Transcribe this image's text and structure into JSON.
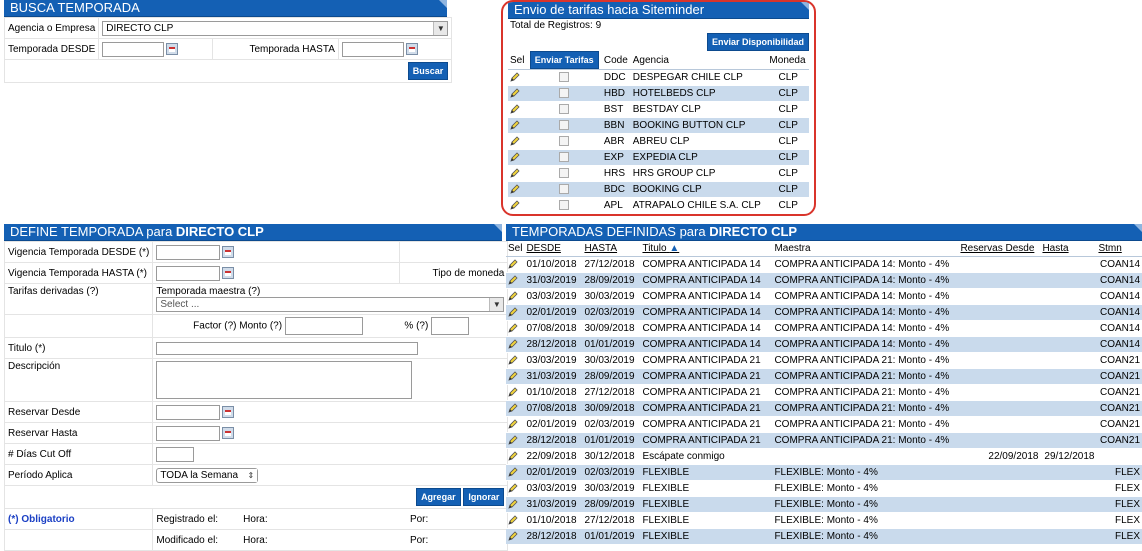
{
  "busca": {
    "title": "BUSCA TEMPORADA",
    "agencia_label": "Agencia o Empresa",
    "agencia_value": "DIRECTO CLP",
    "desde_label": "Temporada DESDE",
    "hasta_label": "Temporada HASTA",
    "buscar_label": "Buscar"
  },
  "envio": {
    "title": "Envio de tarifas hacia Siteminder",
    "total_label": "Total de Registros: 9",
    "enviar_disp_label": "Enviar Disponibilidad",
    "col_sel": "Sel",
    "enviar_tarifas_label": "Enviar Tarifas",
    "col_code": "Code",
    "col_agencia": "Agencia",
    "col_moneda": "Moneda",
    "rows": [
      {
        "code": "DDC",
        "agencia": "DESPEGAR CHILE CLP",
        "moneda": "CLP"
      },
      {
        "code": "HBD",
        "agencia": "HOTELBEDS CLP",
        "moneda": "CLP"
      },
      {
        "code": "BST",
        "agencia": "BESTDAY CLP",
        "moneda": "CLP"
      },
      {
        "code": "BBN",
        "agencia": "BOOKING BUTTON CLP",
        "moneda": "CLP"
      },
      {
        "code": "ABR",
        "agencia": "ABREU CLP",
        "moneda": "CLP"
      },
      {
        "code": "EXP",
        "agencia": "EXPEDIA CLP",
        "moneda": "CLP"
      },
      {
        "code": "HRS",
        "agencia": "HRS GROUP CLP",
        "moneda": "CLP"
      },
      {
        "code": "BDC",
        "agencia": "BOOKING CLP",
        "moneda": "CLP"
      },
      {
        "code": "APL",
        "agencia": "ATRAPALO CHILE S.A. CLP",
        "moneda": "CLP"
      }
    ]
  },
  "define": {
    "title_prefix": "DEFINE TEMPORADA para ",
    "title_bold": "DIRECTO CLP",
    "vig_desde_label": "Vigencia Temporada DESDE (*)",
    "vig_hasta_label": "Vigencia Temporada HASTA (*)",
    "tipo_moneda_label": "Tipo de moneda",
    "tarifas_derivadas_label": "Tarifas derivadas (?)",
    "temporada_maestra_label": "Temporada maestra (?)",
    "select_placeholder": "Select ...",
    "factor_label": "Factor (?)",
    "monto_label": "Monto (?)",
    "pct_label": "% (?)",
    "titulo_label": "Titulo (*)",
    "descripcion_label": "Descripción",
    "reservar_desde_label": "Reservar Desde",
    "reservar_hasta_label": "Reservar Hasta",
    "dias_cutoff_label": "# Días Cut Off",
    "periodo_label": "Período Aplica",
    "periodo_value": "TODA la Semana",
    "agregar_label": "Agregar",
    "ignorar_label": "Ignorar",
    "obligatorio_label": "(*) Obligatorio",
    "registrado_label": "Registrado el:",
    "modificado_label": "Modificado el:",
    "hora_label": "Hora:",
    "por_label": "Por:"
  },
  "temporadas": {
    "title_prefix": "TEMPORADAS DEFINIDAS para ",
    "title_bold": "DIRECTO CLP",
    "col_sel": "Sel",
    "col_desde": "DESDE",
    "col_hasta": "HASTA",
    "col_titulo": "Titulo",
    "col_maestra": "Maestra",
    "col_res_desde": "Reservas Desde",
    "col_res_hasta": "Hasta",
    "col_stmn": "Stmn",
    "rows": [
      {
        "desde": "01/10/2018",
        "hasta": "27/12/2018",
        "titulo": "COMPRA ANTICIPADA 14",
        "maestra": "COMPRA ANTICIPADA 14: Monto - 4%",
        "rd": "",
        "rh": "",
        "stmn": "COAN14"
      },
      {
        "desde": "31/03/2019",
        "hasta": "28/09/2019",
        "titulo": "COMPRA ANTICIPADA 14",
        "maestra": "COMPRA ANTICIPADA 14: Monto - 4%",
        "rd": "",
        "rh": "",
        "stmn": "COAN14"
      },
      {
        "desde": "03/03/2019",
        "hasta": "30/03/2019",
        "titulo": "COMPRA ANTICIPADA 14",
        "maestra": "COMPRA ANTICIPADA 14: Monto - 4%",
        "rd": "",
        "rh": "",
        "stmn": "COAN14"
      },
      {
        "desde": "02/01/2019",
        "hasta": "02/03/2019",
        "titulo": "COMPRA ANTICIPADA 14",
        "maestra": "COMPRA ANTICIPADA 14: Monto - 4%",
        "rd": "",
        "rh": "",
        "stmn": "COAN14"
      },
      {
        "desde": "07/08/2018",
        "hasta": "30/09/2018",
        "titulo": "COMPRA ANTICIPADA 14",
        "maestra": "COMPRA ANTICIPADA 14: Monto - 4%",
        "rd": "",
        "rh": "",
        "stmn": "COAN14"
      },
      {
        "desde": "28/12/2018",
        "hasta": "01/01/2019",
        "titulo": "COMPRA ANTICIPADA 14",
        "maestra": "COMPRA ANTICIPADA 14: Monto - 4%",
        "rd": "",
        "rh": "",
        "stmn": "COAN14"
      },
      {
        "desde": "03/03/2019",
        "hasta": "30/03/2019",
        "titulo": "COMPRA ANTICIPADA 21",
        "maestra": "COMPRA ANTICIPADA 21: Monto - 4%",
        "rd": "",
        "rh": "",
        "stmn": "COAN21"
      },
      {
        "desde": "31/03/2019",
        "hasta": "28/09/2019",
        "titulo": "COMPRA ANTICIPADA 21",
        "maestra": "COMPRA ANTICIPADA 21: Monto - 4%",
        "rd": "",
        "rh": "",
        "stmn": "COAN21"
      },
      {
        "desde": "01/10/2018",
        "hasta": "27/12/2018",
        "titulo": "COMPRA ANTICIPADA 21",
        "maestra": "COMPRA ANTICIPADA 21: Monto - 4%",
        "rd": "",
        "rh": "",
        "stmn": "COAN21"
      },
      {
        "desde": "07/08/2018",
        "hasta": "30/09/2018",
        "titulo": "COMPRA ANTICIPADA 21",
        "maestra": "COMPRA ANTICIPADA 21: Monto - 4%",
        "rd": "",
        "rh": "",
        "stmn": "COAN21"
      },
      {
        "desde": "02/01/2019",
        "hasta": "02/03/2019",
        "titulo": "COMPRA ANTICIPADA 21",
        "maestra": "COMPRA ANTICIPADA 21: Monto - 4%",
        "rd": "",
        "rh": "",
        "stmn": "COAN21"
      },
      {
        "desde": "28/12/2018",
        "hasta": "01/01/2019",
        "titulo": "COMPRA ANTICIPADA 21",
        "maestra": "COMPRA ANTICIPADA 21: Monto - 4%",
        "rd": "",
        "rh": "",
        "stmn": "COAN21"
      },
      {
        "desde": "22/09/2018",
        "hasta": "30/12/2018",
        "titulo": "Escápate conmigo",
        "maestra": "",
        "rd": "22/09/2018",
        "rh": "29/12/2018",
        "stmn": ""
      },
      {
        "desde": "02/01/2019",
        "hasta": "02/03/2019",
        "titulo": "FLEXIBLE",
        "maestra": "FLEXIBLE: Monto - 4%",
        "rd": "",
        "rh": "",
        "stmn": "FLEX"
      },
      {
        "desde": "03/03/2019",
        "hasta": "30/03/2019",
        "titulo": "FLEXIBLE",
        "maestra": "FLEXIBLE: Monto - 4%",
        "rd": "",
        "rh": "",
        "stmn": "FLEX"
      },
      {
        "desde": "31/03/2019",
        "hasta": "28/09/2019",
        "titulo": "FLEXIBLE",
        "maestra": "FLEXIBLE: Monto - 4%",
        "rd": "",
        "rh": "",
        "stmn": "FLEX"
      },
      {
        "desde": "01/10/2018",
        "hasta": "27/12/2018",
        "titulo": "FLEXIBLE",
        "maestra": "FLEXIBLE: Monto - 4%",
        "rd": "",
        "rh": "",
        "stmn": "FLEX"
      },
      {
        "desde": "28/12/2018",
        "hasta": "01/01/2019",
        "titulo": "FLEXIBLE",
        "maestra": "FLEXIBLE: Monto - 4%",
        "rd": "",
        "rh": "",
        "stmn": "FLEX"
      }
    ]
  },
  "colors": {
    "header_blue": "#1460b4",
    "row_alt": "#c9daec",
    "highlight_red": "#d9342b",
    "link_blue": "#1a3fc4"
  }
}
